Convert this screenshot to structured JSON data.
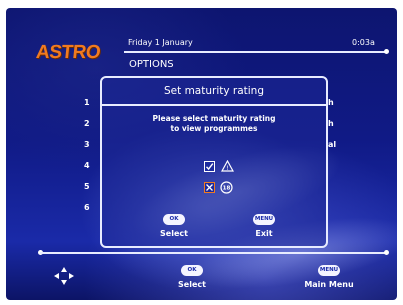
{
  "header": {
    "logo": "ASTRO",
    "date": "Friday 1 January",
    "time": "0:03a",
    "section_title": "OPTIONS"
  },
  "background_list": {
    "numbers": [
      "1",
      "2",
      "3",
      "4",
      "5",
      "6"
    ],
    "right_text": [
      "h",
      "h",
      "al"
    ]
  },
  "dialog": {
    "title": "Set maturity rating",
    "instruction_line1": "Please select maturity rating",
    "instruction_line2": "to view programmes",
    "ratings": [
      {
        "state": "checked",
        "badge": "warning"
      },
      {
        "state": "crossed",
        "badge": "18"
      }
    ],
    "buttons": [
      {
        "key": "OK",
        "label": "Select"
      },
      {
        "key": "MENU",
        "label": "Exit"
      }
    ]
  },
  "footer": {
    "ok_key": "OK",
    "ok_label": "Select",
    "menu_key": "MENU",
    "menu_label": "Main Menu"
  },
  "colors": {
    "accent_orange": "#f07a20",
    "background_blue": "#101a86",
    "line_white": "#e8ecff"
  }
}
